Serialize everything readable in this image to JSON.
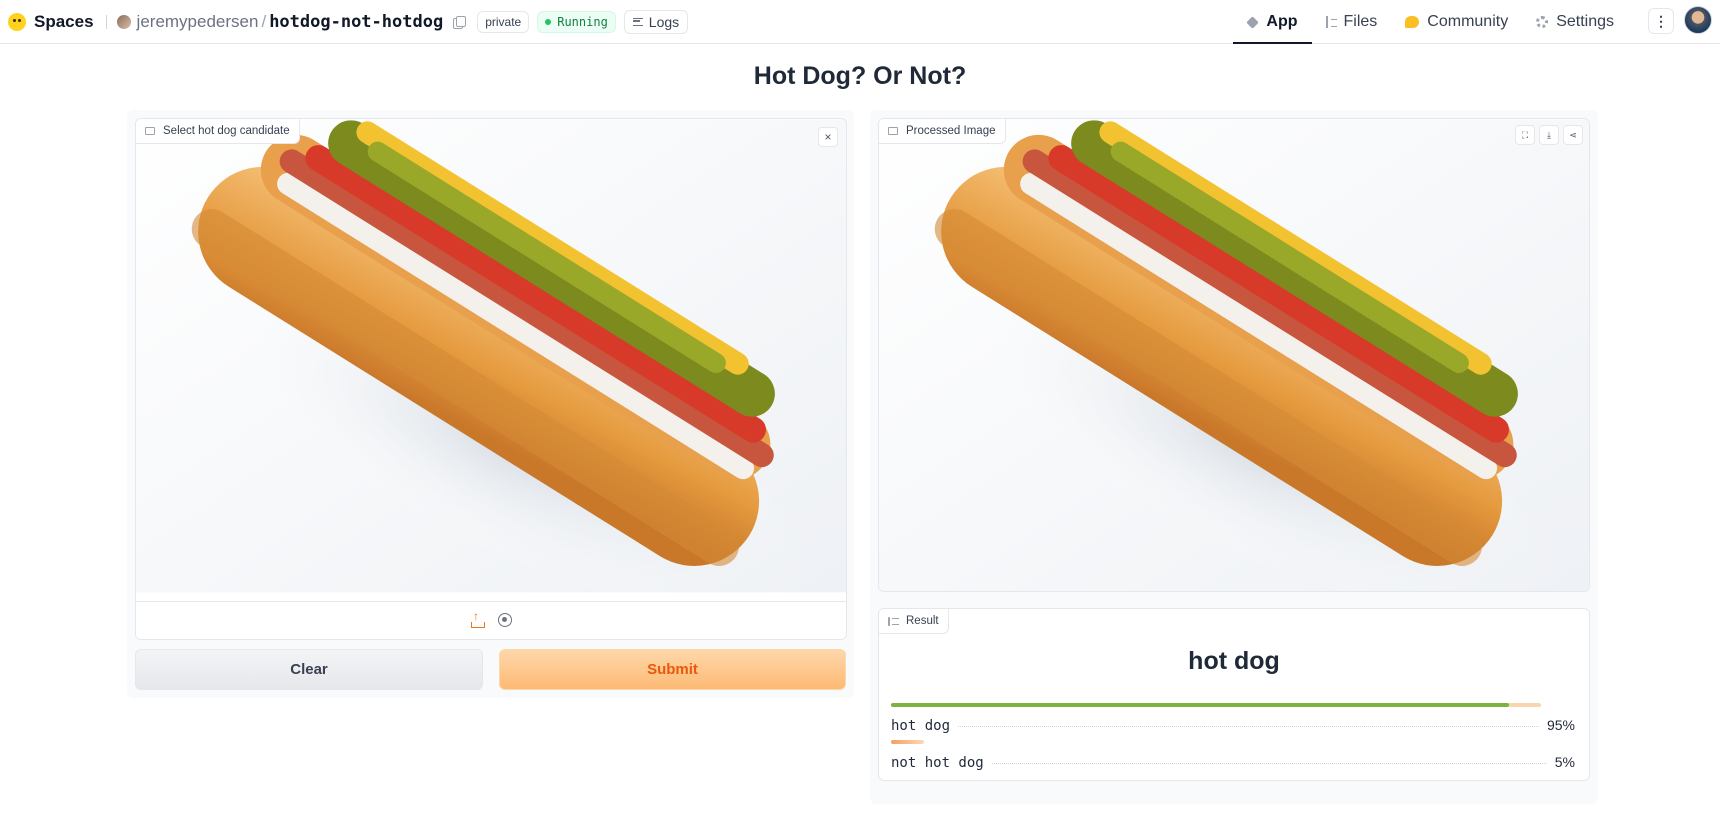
{
  "nav": {
    "brand": "Spaces",
    "owner": "jeremypedersen",
    "slash": "/",
    "repo": "hotdog-not-hotdog",
    "visibility": "private",
    "status": "Running",
    "logs": "Logs",
    "tabs": [
      {
        "label": "App",
        "icon": "cube-icon",
        "active": true
      },
      {
        "label": "Files",
        "icon": "files-icon",
        "active": false
      },
      {
        "label": "Community",
        "icon": "community-icon",
        "active": false
      },
      {
        "label": "Settings",
        "icon": "gear-icon",
        "active": false
      }
    ],
    "more": "⋮"
  },
  "page": {
    "title": "Hot Dog? Or Not?"
  },
  "input": {
    "label": "Select hot dog candidate",
    "close": "×",
    "clear": "Clear",
    "submit": "Submit"
  },
  "output": {
    "label": "Processed Image",
    "tools": [
      "⛶",
      "⤓",
      "⋖"
    ]
  },
  "result": {
    "label": "Result",
    "top_label": "hot dog",
    "confidences": [
      {
        "name": "hot dog",
        "pct": "95%",
        "value": 0.95
      },
      {
        "name": "not hot dog",
        "pct": "5%",
        "value": 0.05
      }
    ]
  },
  "colors": {
    "accent": "#f97316",
    "running": "#22c55e",
    "bar_primary": "#7cb342",
    "bar_secondary": "#f5a060"
  }
}
